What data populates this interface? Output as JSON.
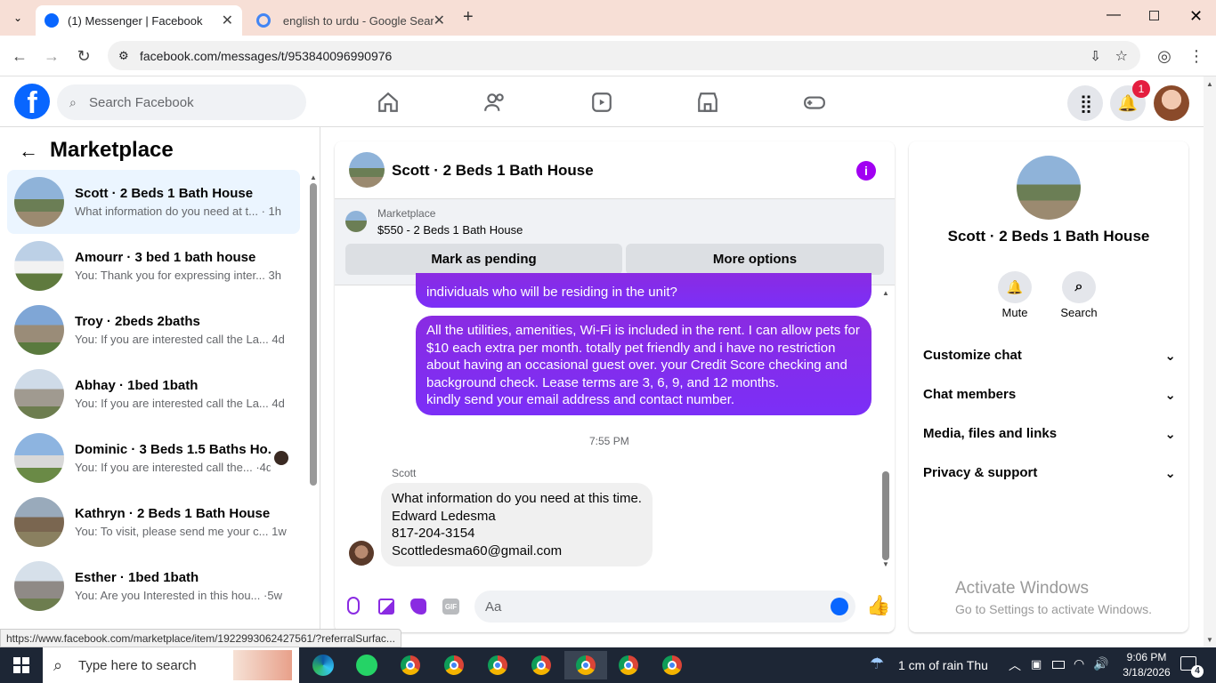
{
  "browser": {
    "tabs": [
      {
        "title": "(1) Messenger | Facebook"
      },
      {
        "title": "english to urdu - Google Search"
      }
    ],
    "url": "facebook.com/messages/t/953840096990976",
    "status_url": "https://www.facebook.com/marketplace/item/1922993062427561/?referralSurfac..."
  },
  "fb": {
    "search_placeholder": "Search Facebook",
    "notifications_count": "1"
  },
  "left": {
    "title": "Marketplace",
    "conversations": [
      {
        "name": "Scott · 2 Beds 1 Bath House",
        "preview": "What information do you need at t...",
        "time": "1h"
      },
      {
        "name": "Amourr · 3 bed 1 bath house",
        "preview": "You: Thank you for expressing inter...",
        "time": "3h"
      },
      {
        "name": "Troy · 2beds 2baths",
        "preview": "You: If you are interested call the La...",
        "time": "4d"
      },
      {
        "name": "Abhay · 1bed 1bath",
        "preview": "You: If you are interested call the La...",
        "time": "4d"
      },
      {
        "name": "Dominic · 3 Beds 1.5 Baths Ho...",
        "preview": "You: If you are interested call the...",
        "time": "4d"
      },
      {
        "name": "Kathryn · 2 Beds 1 Bath House",
        "preview": "You: To visit, please send me your c...",
        "time": "1w"
      },
      {
        "name": "Esther · 1bed 1bath",
        "preview": "You: Are you Interested in this hou...",
        "time": "5w"
      }
    ]
  },
  "chat": {
    "title": "Scott · 2 Beds 1 Bath House",
    "marketplace_label": "Marketplace",
    "listing": "$550 - 2 Beds 1 Bath House",
    "mark_pending": "Mark as pending",
    "more_options": "More options",
    "msg_partial": "individuals who will be residing in the unit?",
    "msg_me_lines": [
      "All the utilities, amenities, Wi-Fi is included in the rent. I can allow pets for",
      "$10 each extra per month. totally pet friendly and i have no restriction",
      "about having an occasional guest over. your Credit Score checking and",
      "background check. Lease terms are 3, 6, 9, and 12 months.",
      "kindly send your email address and contact number."
    ],
    "timestamp": "7:55 PM",
    "sender": "Scott",
    "msg_them_lines": [
      "What information do you need at this time.",
      "Edward Ledesma",
      "817-204-3154",
      "Scottledesma60@gmail.com"
    ],
    "composer_placeholder": "Aa"
  },
  "right": {
    "title": "Scott · 2 Beds 1 Bath House",
    "mute": "Mute",
    "search": "Search",
    "sections": [
      "Customize chat",
      "Chat members",
      "Media, files and links",
      "Privacy & support"
    ],
    "activate_title": "Activate Windows",
    "activate_sub": "Go to Settings to activate Windows."
  },
  "taskbar": {
    "search_placeholder": "Type here to search",
    "weather": "1 cm of rain Thu",
    "time": "9:06 PM",
    "date": "3/18/2026",
    "notif_count": "4"
  },
  "colors": {
    "brand": "#0866ff",
    "bubble": "#7b2ff7",
    "notification": "#e41e3f"
  }
}
